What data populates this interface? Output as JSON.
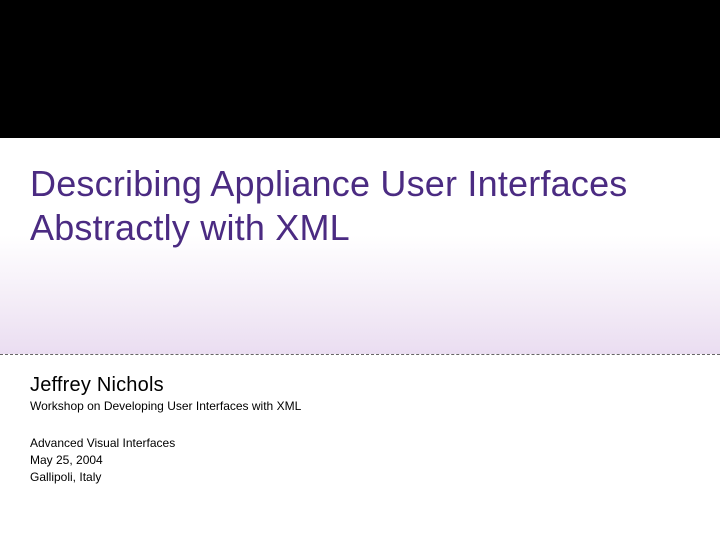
{
  "slide": {
    "title": "Describing Appliance User Interfaces Abstractly with XML",
    "author": "Jeffrey Nichols",
    "workshop": "Workshop on Developing User Interfaces with XML",
    "conference": "Advanced Visual Interfaces",
    "date": "May 25, 2004",
    "location": "Gallipoli, Italy"
  }
}
